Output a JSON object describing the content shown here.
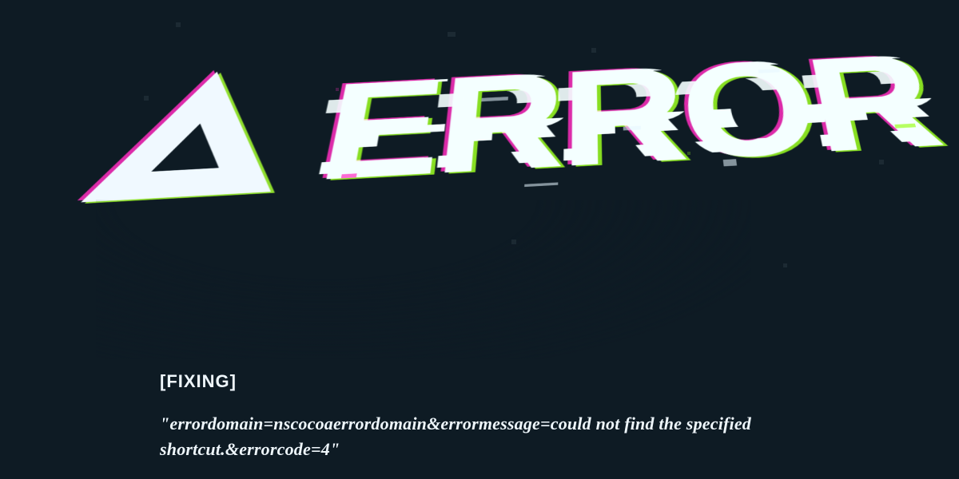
{
  "colors": {
    "background": "#0e1b24",
    "text": "#eef6fb",
    "glitch_magenta": "#ff2cc0",
    "glitch_green": "#9bff1f",
    "glyph_white": "#f4ffff"
  },
  "headline": {
    "icon": "warning-triangle-icon",
    "word": "ERROR"
  },
  "caption": {
    "tag": "[FIXING]",
    "message": "\"errordomain=nscocoaerrordomain&errormessage=could not find the specified shortcut.&errorcode=4\""
  }
}
